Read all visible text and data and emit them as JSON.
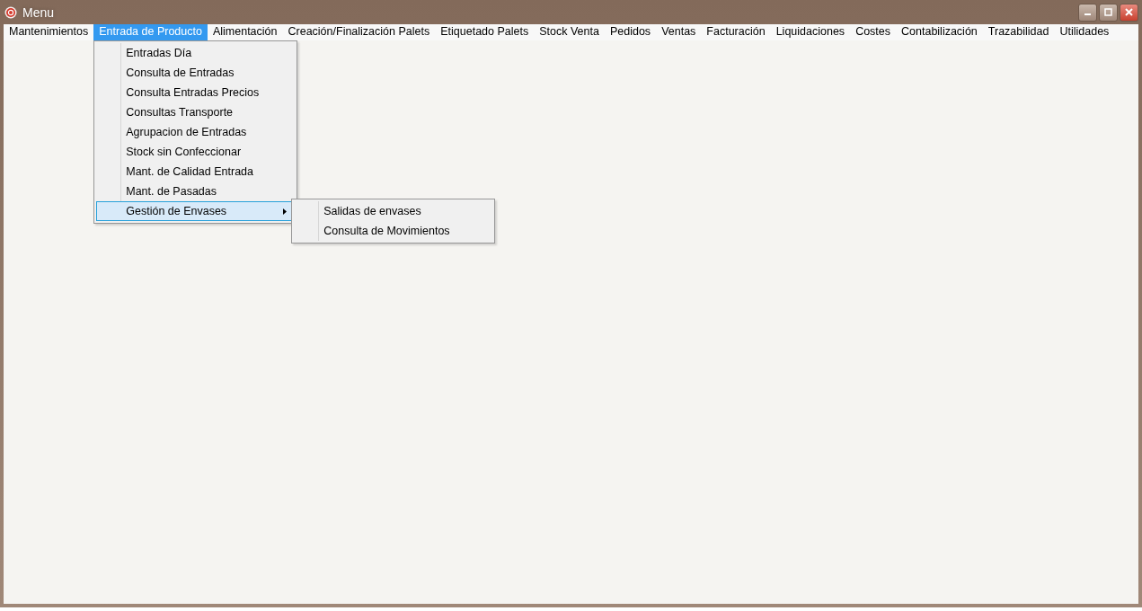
{
  "window": {
    "title": "Menu"
  },
  "menubar": [
    {
      "label": "Mantenimientos",
      "selected": false
    },
    {
      "label": "Entrada de Producto",
      "selected": true
    },
    {
      "label": "Alimentación",
      "selected": false
    },
    {
      "label": "Creación/Finalización Palets",
      "selected": false
    },
    {
      "label": "Etiquetado Palets",
      "selected": false
    },
    {
      "label": "Stock Venta",
      "selected": false
    },
    {
      "label": "Pedidos",
      "selected": false
    },
    {
      "label": "Ventas",
      "selected": false
    },
    {
      "label": "Facturación",
      "selected": false
    },
    {
      "label": "Liquidaciones",
      "selected": false
    },
    {
      "label": "Costes",
      "selected": false
    },
    {
      "label": "Contabilización",
      "selected": false
    },
    {
      "label": "Trazabilidad",
      "selected": false
    },
    {
      "label": "Utilidades",
      "selected": false
    }
  ],
  "dropdown": [
    {
      "label": "Entradas Día",
      "selected": false,
      "has_submenu": false
    },
    {
      "label": "Consulta de Entradas",
      "selected": false,
      "has_submenu": false
    },
    {
      "label": "Consulta Entradas Precios",
      "selected": false,
      "has_submenu": false
    },
    {
      "label": "Consultas Transporte",
      "selected": false,
      "has_submenu": false
    },
    {
      "label": "Agrupacion de Entradas",
      "selected": false,
      "has_submenu": false
    },
    {
      "label": "Stock sin Confeccionar",
      "selected": false,
      "has_submenu": false
    },
    {
      "label": "Mant. de Calidad Entrada",
      "selected": false,
      "has_submenu": false
    },
    {
      "label": "Mant. de Pasadas",
      "selected": false,
      "has_submenu": false
    },
    {
      "label": "Gestión de Envases",
      "selected": true,
      "has_submenu": true
    }
  ],
  "submenu": [
    {
      "label": "Salidas de envases",
      "selected": false
    },
    {
      "label": "Consulta de Movimientos",
      "selected": false
    }
  ]
}
